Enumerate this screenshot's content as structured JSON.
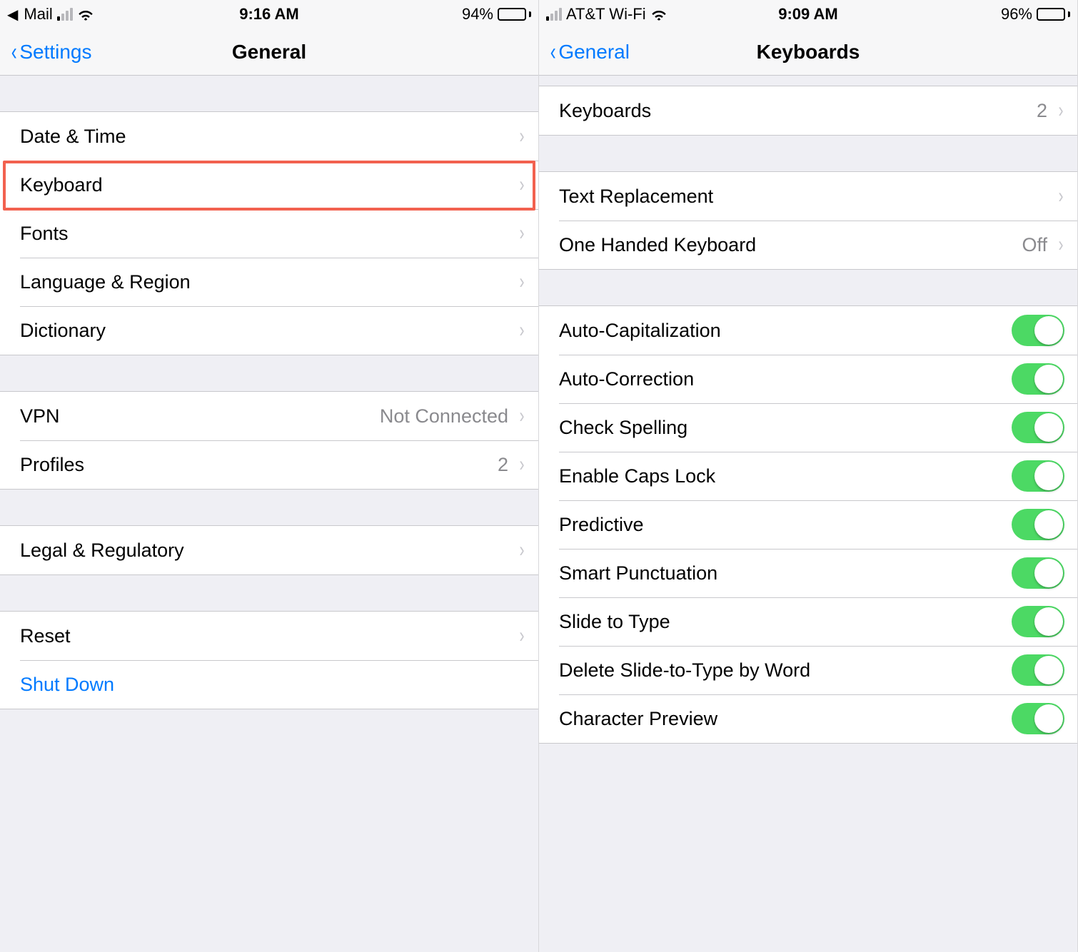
{
  "left": {
    "status": {
      "back_app": "Mail",
      "carrier": "",
      "signal_bars_on": 1,
      "time": "9:16 AM",
      "battery_pct": "94%"
    },
    "nav": {
      "back": "Settings",
      "title": "General"
    },
    "groups": [
      {
        "rows": [
          {
            "label": "Date & Time",
            "chevron": true
          },
          {
            "label": "Keyboard",
            "chevron": true,
            "highlighted": true
          },
          {
            "label": "Fonts",
            "chevron": true
          },
          {
            "label": "Language & Region",
            "chevron": true
          },
          {
            "label": "Dictionary",
            "chevron": true
          }
        ]
      },
      {
        "rows": [
          {
            "label": "VPN",
            "detail": "Not Connected",
            "chevron": true
          },
          {
            "label": "Profiles",
            "detail": "2",
            "chevron": true
          }
        ]
      },
      {
        "rows": [
          {
            "label": "Legal & Regulatory",
            "chevron": true
          }
        ]
      },
      {
        "rows": [
          {
            "label": "Reset",
            "chevron": true
          },
          {
            "label": "Shut Down",
            "blue": true
          }
        ]
      }
    ]
  },
  "right": {
    "status": {
      "carrier": "AT&T Wi-Fi",
      "signal_bars_on": 1,
      "time": "9:09 AM",
      "battery_pct": "96%"
    },
    "nav": {
      "back": "General",
      "title": "Keyboards"
    },
    "groups": [
      {
        "rows": [
          {
            "label": "Keyboards",
            "detail": "2",
            "chevron": true
          }
        ]
      },
      {
        "rows": [
          {
            "label": "Text Replacement",
            "chevron": true
          },
          {
            "label": "One Handed Keyboard",
            "detail": "Off",
            "chevron": true
          }
        ]
      },
      {
        "rows": [
          {
            "label": "Auto-Capitalization",
            "switch": true
          },
          {
            "label": "Auto-Correction",
            "switch": true
          },
          {
            "label": "Check Spelling",
            "switch": true
          },
          {
            "label": "Enable Caps Lock",
            "switch": true
          },
          {
            "label": "Predictive",
            "switch": true
          },
          {
            "label": "Smart Punctuation",
            "switch": true
          },
          {
            "label": "Slide to Type",
            "switch": true
          },
          {
            "label": "Delete Slide-to-Type by Word",
            "switch": true
          },
          {
            "label": "Character Preview",
            "switch": true
          }
        ]
      }
    ]
  }
}
